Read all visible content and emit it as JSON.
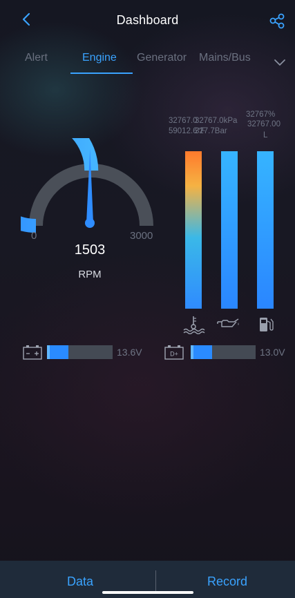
{
  "header": {
    "title": "Dashboard",
    "back_icon": "chevron-left-icon",
    "share_icon": "share-icon",
    "accent_color": "#3aa3ff"
  },
  "tabs": {
    "items": [
      {
        "label": "Alert",
        "active": false
      },
      {
        "label": "Engine",
        "active": true
      },
      {
        "label": "Generator",
        "active": false
      },
      {
        "label": "Mains/Bus",
        "active": false
      }
    ],
    "more_icon": "chevron-down-icon"
  },
  "gauge": {
    "value": "1503",
    "value_number": 1503,
    "unit": "RPM",
    "min": "0",
    "max": "3000",
    "min_number": 0,
    "max_number": 3000
  },
  "bars": {
    "temperature": {
      "value": "32767.0",
      "unit_value": "59012.6°F",
      "icon": "coolant-temperature-icon",
      "level": 1.0
    },
    "oil_pressure": {
      "value": "32767.0kPa",
      "unit_value": "327.7Bar",
      "icon": "oil-pressure-icon",
      "level": 1.0
    },
    "fuel": {
      "percent": "32767%",
      "value": "32767.00",
      "unit": "L",
      "icon": "fuel-pump-icon",
      "level": 1.0
    }
  },
  "voltages": {
    "battery": {
      "label": "- +",
      "value": "13.6V",
      "icon": "battery-icon",
      "level": 0.33
    },
    "d_plus": {
      "label": "D+",
      "value": "13.0V",
      "icon": "d-plus-icon",
      "level": 0.33
    }
  },
  "bottom": {
    "data_label": "Data",
    "record_label": "Record"
  }
}
